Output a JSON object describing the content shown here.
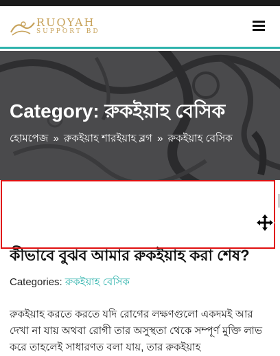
{
  "header": {
    "logo_main": "RUQYAH",
    "logo_sub": "SUPPORT BD",
    "brand_color": "#c7a25a",
    "accent_color": "#2fb3ad",
    "menu_icon": "hamburger-icon"
  },
  "hero": {
    "title": "Category: রুকইয়াহ বেসিক",
    "breadcrumb": {
      "home": "হোমপেজ",
      "separator": "»",
      "parent": "রুকইয়াহ শারইয়াহ ব্লগ",
      "current": "রুকইয়াহ বেসিক"
    }
  },
  "post": {
    "title": "কীভাবে বুঝব আমার রুকইয়াহ করা শেষ?",
    "categories_label": "Categories:",
    "category": "রুকইয়াহ বেসিক",
    "excerpt": "রুকইয়াহ করতে করতে যদি রোগের লক্ষণগুলো একদমই আর দেখা না যায় অথবা রোগী তার অসুস্থতা থেকে সম্পূর্ণ মুক্তি লাভ করে তাহলেই সাধারণত বলা যায়, তার রুকইয়াহ"
  },
  "overlay": {
    "selection_color": "#e01010",
    "cursor_icon": "move-cursor-icon"
  }
}
